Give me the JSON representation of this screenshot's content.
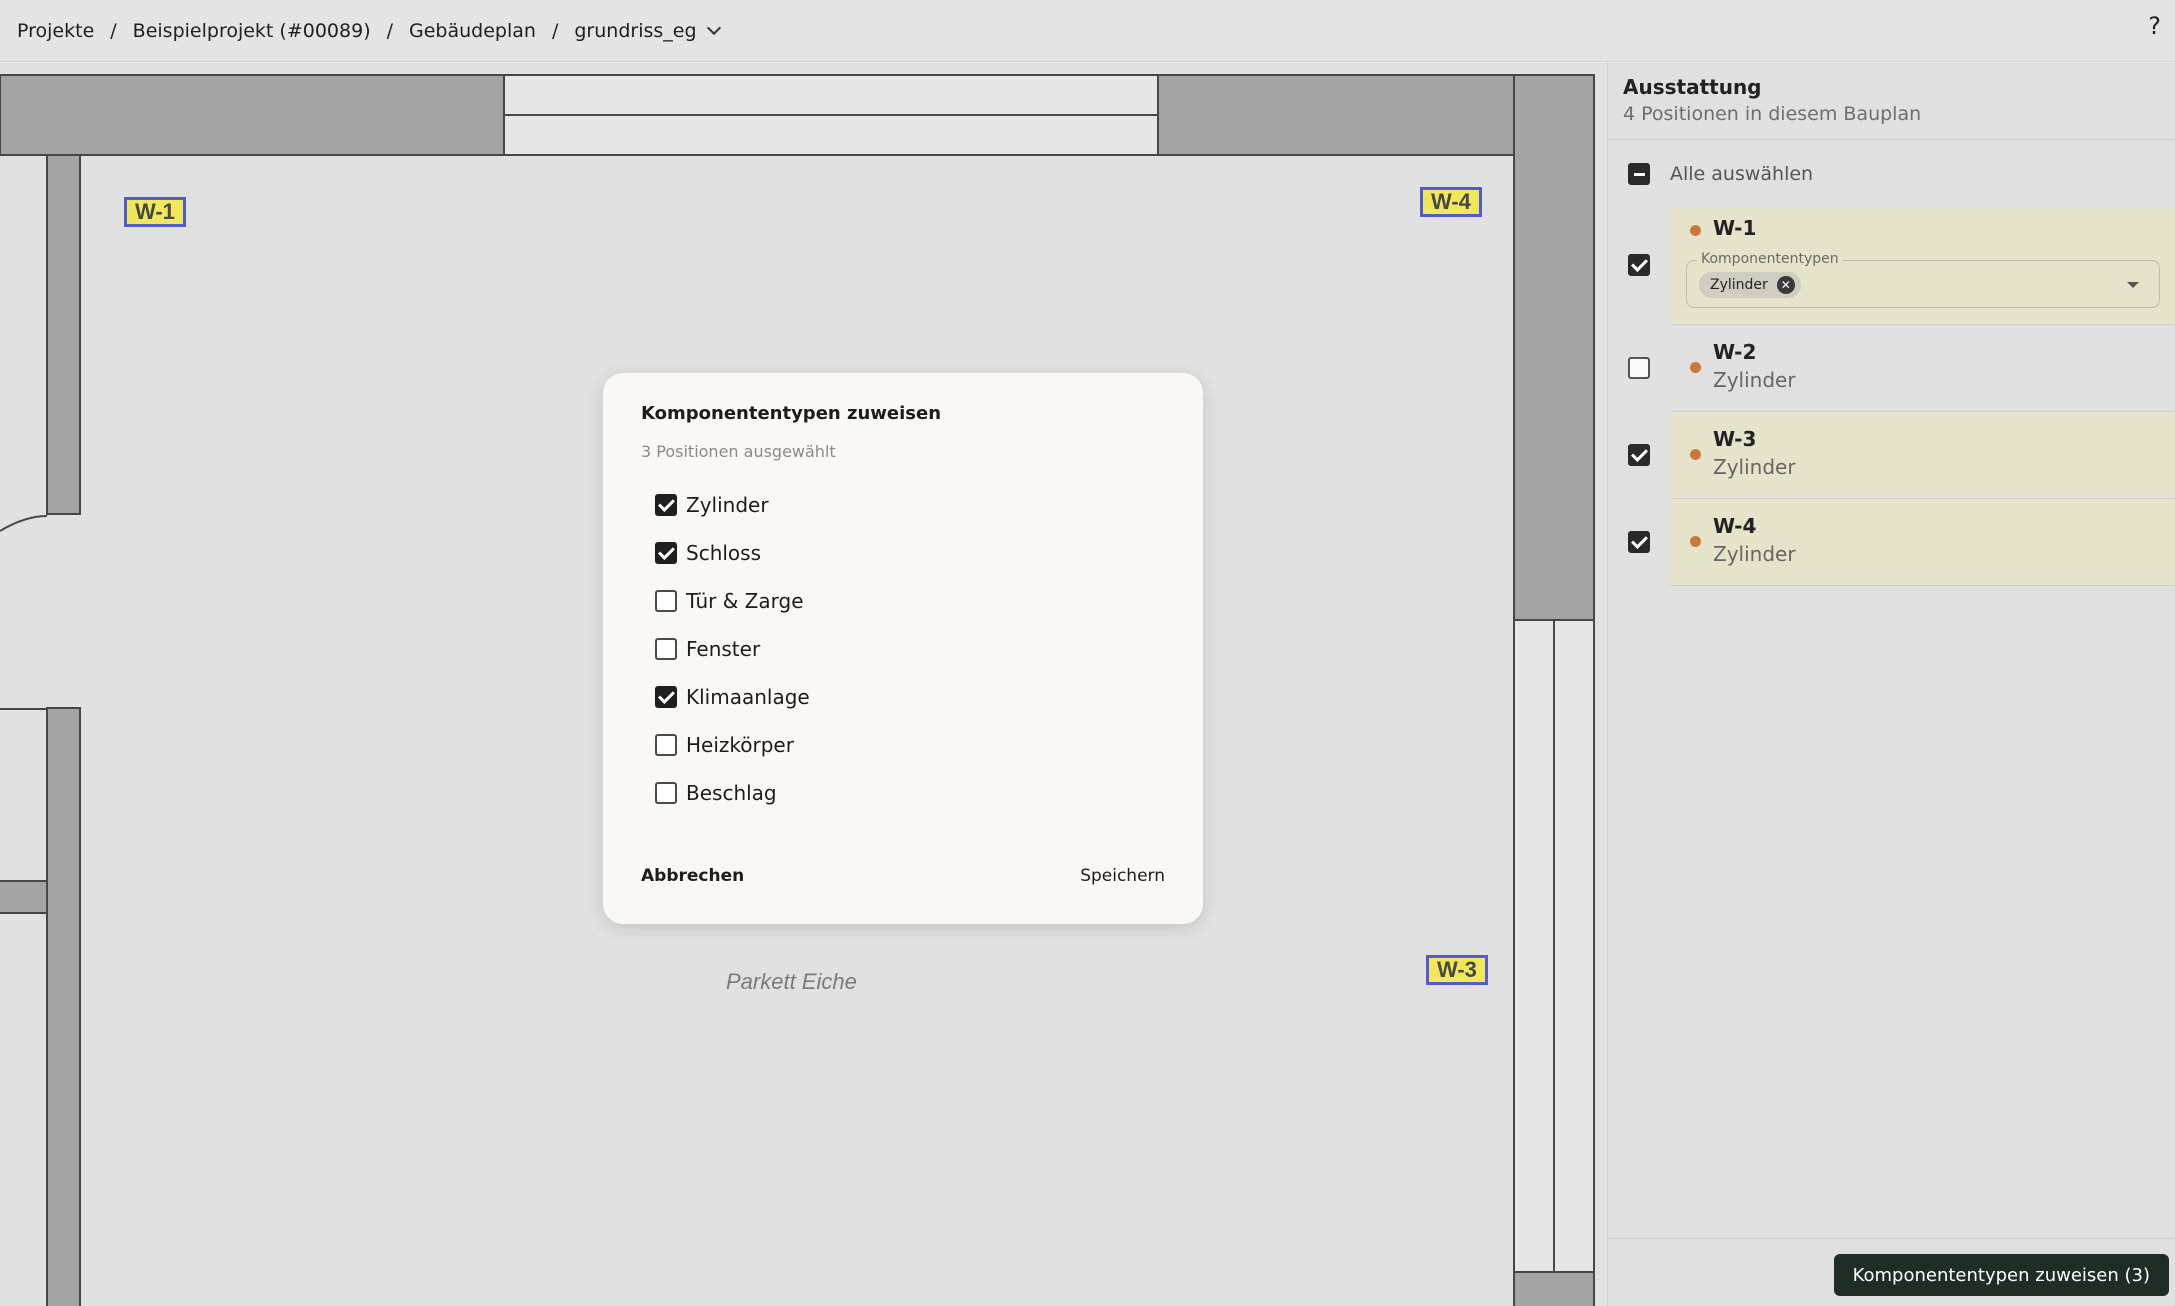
{
  "breadcrumb": {
    "items": [
      "Projekte",
      "Beispielprojekt (#00089)",
      "Gebäudeplan",
      "grundriss_eg"
    ],
    "separator": "/"
  },
  "help_label": "?",
  "plan": {
    "labels": [
      "W-1",
      "W-4",
      "W-3"
    ],
    "room_text": "Parkett Eiche"
  },
  "dialog": {
    "title": "Komponententypen zuweisen",
    "subtitle": "3 Positionen ausgewählt",
    "options": [
      {
        "label": "Zylinder",
        "checked": true
      },
      {
        "label": "Schloss",
        "checked": true
      },
      {
        "label": "Tür & Zarge",
        "checked": false
      },
      {
        "label": "Fenster",
        "checked": false
      },
      {
        "label": "Klimaanlage",
        "checked": true
      },
      {
        "label": "Heizkörper",
        "checked": false
      },
      {
        "label": "Beschlag",
        "checked": false
      }
    ],
    "cancel_label": "Abbrechen",
    "save_label": "Speichern"
  },
  "sidebar": {
    "title": "Ausstattung",
    "subtitle": "4 Positionen in diesem Bauplan",
    "select_all_label": "Alle auswählen",
    "items": [
      {
        "name": "W-1",
        "type": "Zylinder",
        "checked": true,
        "expanded": true,
        "field_label": "Komponententypen",
        "chip": "Zylinder"
      },
      {
        "name": "W-2",
        "type": "Zylinder",
        "checked": false
      },
      {
        "name": "W-3",
        "type": "Zylinder",
        "checked": true
      },
      {
        "name": "W-4",
        "type": "Zylinder",
        "checked": true
      }
    ],
    "assign_button_label": "Komponententypen zuweisen (3)"
  },
  "colors": {
    "marker_fill": "#f3e62a",
    "marker_border": "#1f2bc9",
    "selected_row": "#e6e3cb",
    "status_dot": "#c77a3c",
    "primary_button": "#1e2e26"
  }
}
